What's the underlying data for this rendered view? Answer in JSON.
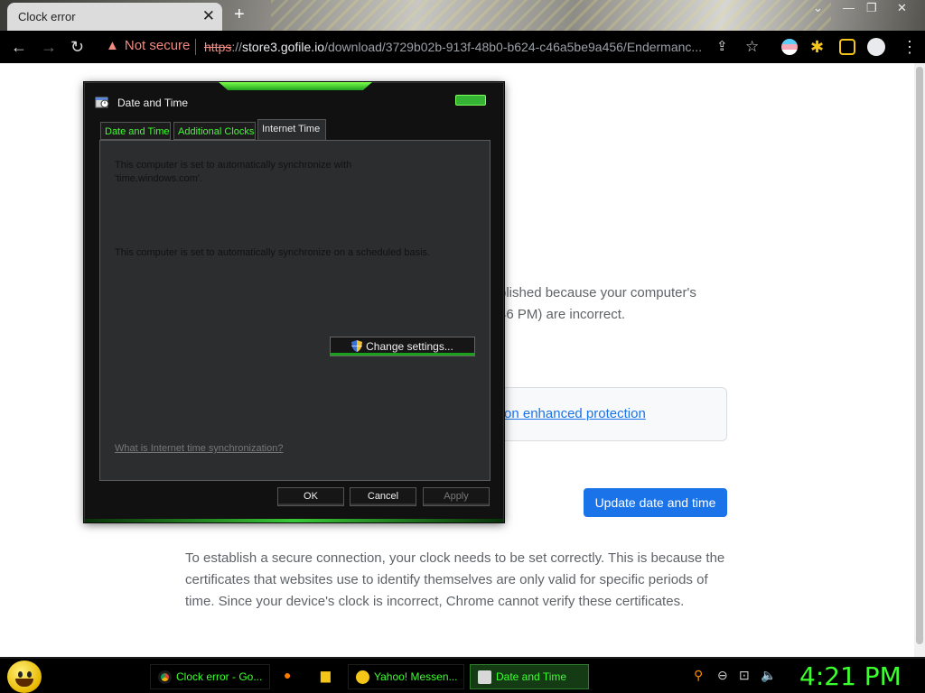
{
  "browser": {
    "tab_title": "Clock error",
    "tab_close": "✕",
    "new_tab": "+",
    "security_label": "Not secure",
    "url_scheme": "https",
    "url_sep": "://",
    "url_host": "store3.gofile.io",
    "url_path": "/download/3729b02b-913f-48b0-b624-c46a5be9a456/Endermanc..."
  },
  "page": {
    "error_line1": "blished because your computer's",
    "error_line2": "46 PM) are incorrect.",
    "protection_link": "on enhanced protection",
    "update_button": "Update date and time",
    "explanation": "To establish a secure connection, your clock needs to be set correctly. This is because the certificates that websites use to identify themselves are only valid for specific periods of time. Since your device's clock is incorrect, Chrome cannot verify these certificates."
  },
  "dialog": {
    "title": "Date and Time",
    "tabs": [
      "Date and Time",
      "Additional Clocks",
      "Internet Time"
    ],
    "active_tab": "Internet Time",
    "sync_text_line1": "This computer is set to automatically synchronize with",
    "sync_text_line2": "'time.windows.com'.",
    "schedule_text": "This computer is set to automatically synchronize on a scheduled basis.",
    "change_settings": "Change settings...",
    "help_link": "What is Internet time synchronization?",
    "ok": "OK",
    "cancel": "Cancel",
    "apply": "Apply"
  },
  "taskbar": {
    "tasks": [
      "Clock error - Go...",
      "Yahoo! Messen...",
      "Date and Time"
    ],
    "clock": "4:21 PM"
  },
  "colors": {
    "accent_green": "#3cff2e",
    "chrome_blue": "#1a73e8",
    "warning_red": "#f28b82"
  }
}
